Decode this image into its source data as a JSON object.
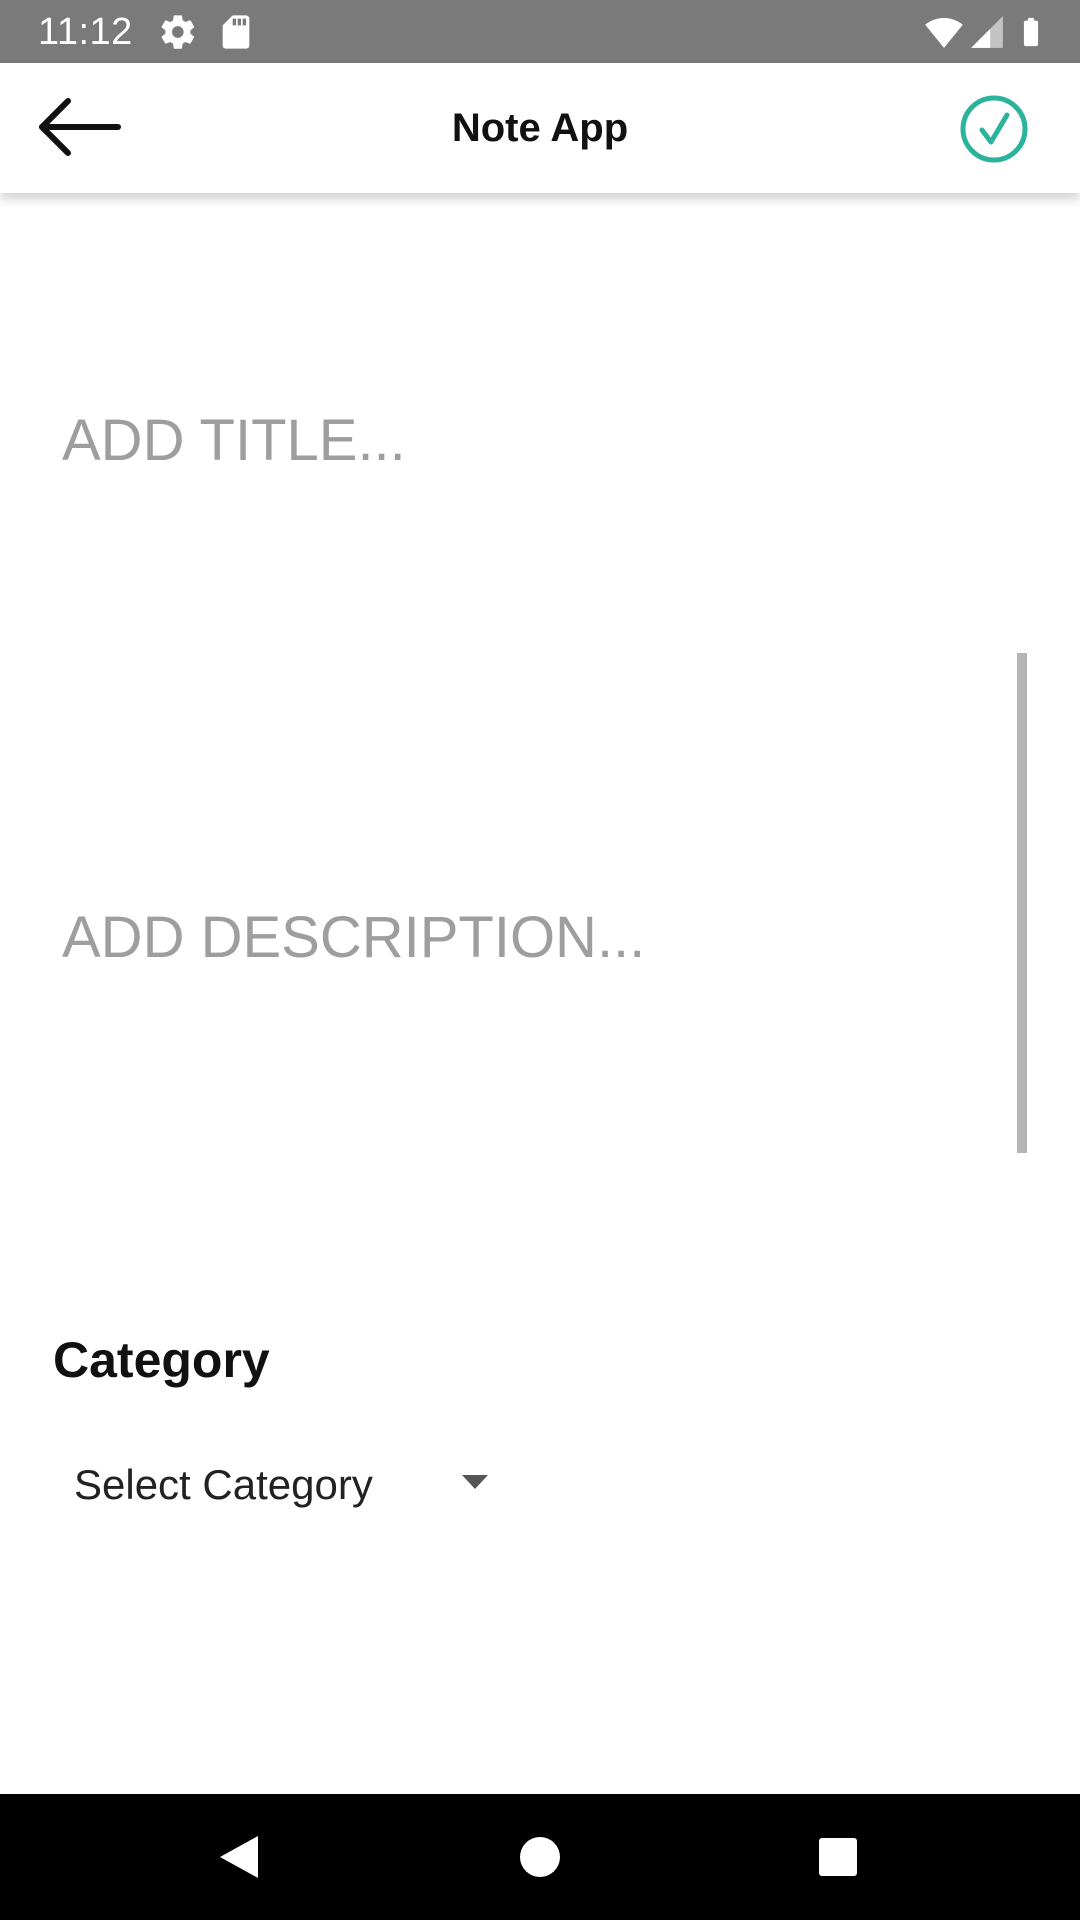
{
  "status_bar": {
    "time": "11:12",
    "icons": [
      "gear-icon",
      "sd-card-icon",
      "wifi-icon",
      "signal-icon",
      "battery-icon"
    ]
  },
  "app_bar": {
    "title": "Note App",
    "back_icon": "arrow-left-icon",
    "save_icon": "check-circle-icon"
  },
  "form": {
    "title_placeholder": "ADD TITLE...",
    "title_value": "",
    "description_placeholder": "ADD DESCRIPTION...",
    "description_value": "",
    "category_label": "Category",
    "category_selected": "Select Category"
  },
  "nav_bar": {
    "buttons": [
      "back-triangle-icon",
      "home-circle-icon",
      "recents-square-icon"
    ]
  },
  "colors": {
    "status_bar": "#7a7a7a",
    "accent": "#2bb39b",
    "placeholder": "#9e9e9e",
    "nav_bar": "#000000"
  }
}
